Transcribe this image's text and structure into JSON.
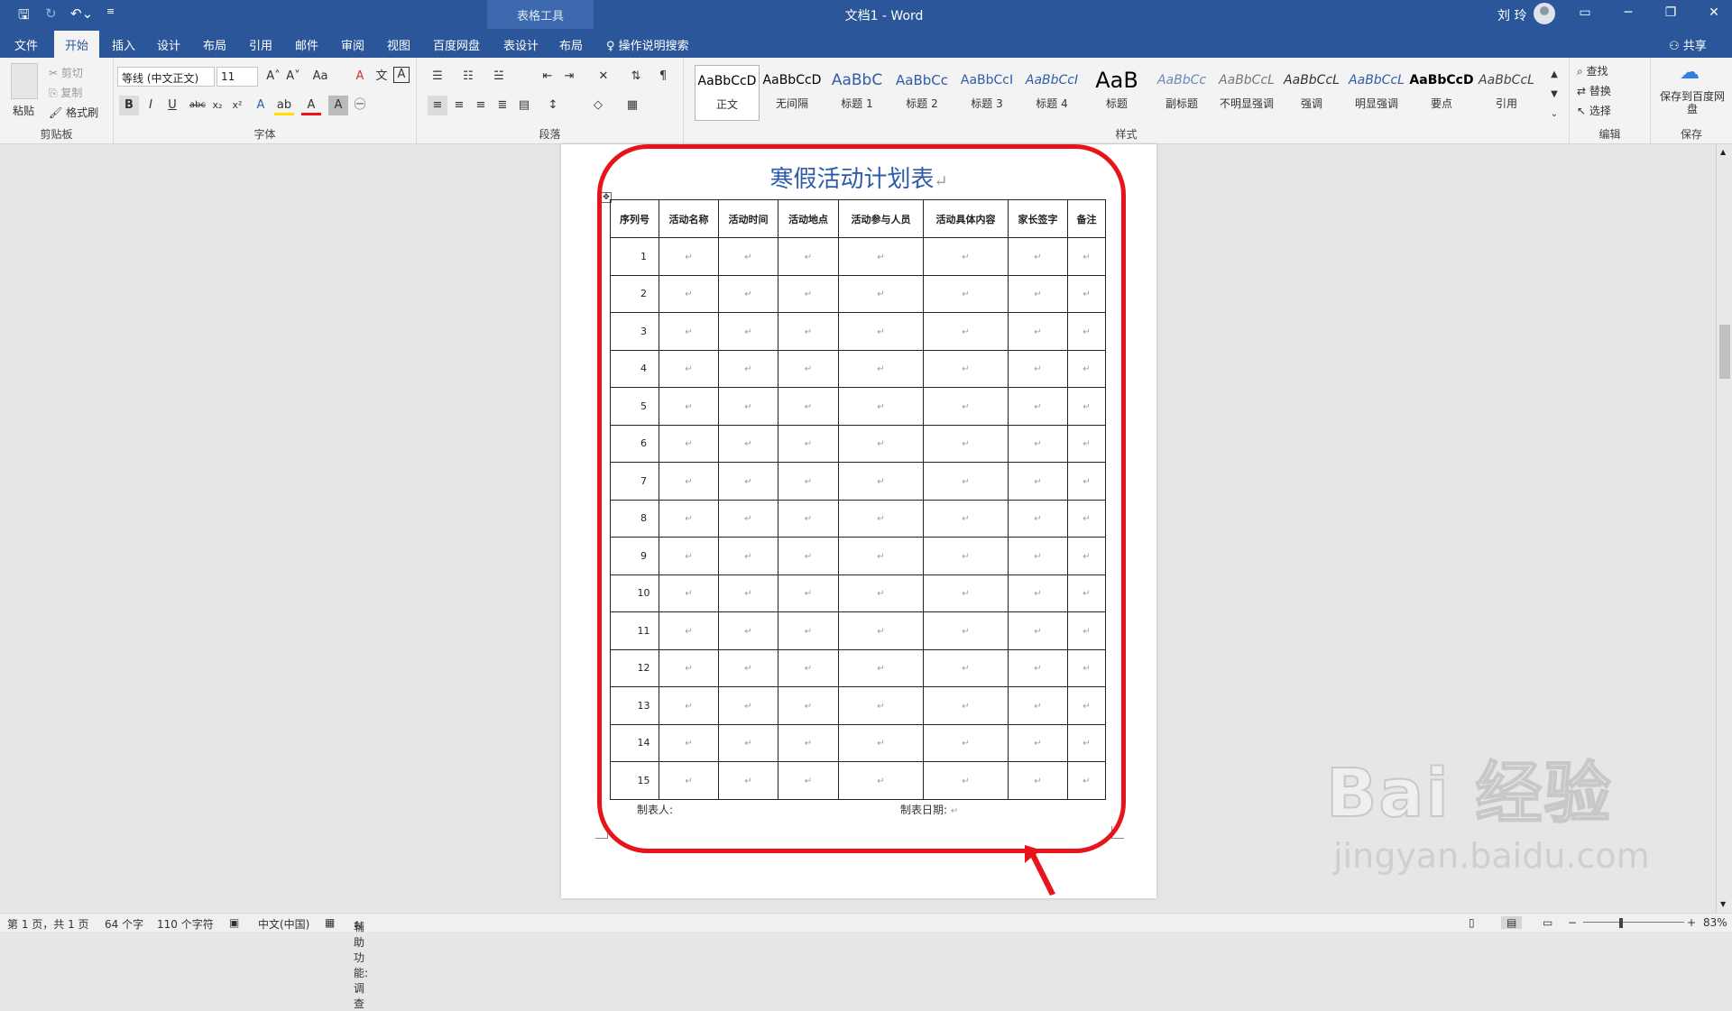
{
  "titlebar": {
    "doc_title": "文档1  -  Word",
    "context_tool": "表格工具",
    "user": "刘 玲",
    "qa_icons": [
      "save-icon",
      "redo-icon",
      "undo-icon",
      "customize-icon"
    ]
  },
  "tabs": [
    "文件",
    "开始",
    "插入",
    "设计",
    "布局",
    "引用",
    "邮件",
    "审阅",
    "视图",
    "百度网盘",
    "表设计",
    "布局"
  ],
  "active_tab": "开始",
  "tell_me": "操作说明搜索",
  "share": "共享",
  "ribbon": {
    "clipboard": {
      "paste": "粘贴",
      "cut": "剪切",
      "copy": "复制",
      "format_painter": "格式刷",
      "label": "剪贴板"
    },
    "font": {
      "name": "等线 (中文正文)",
      "size": "11",
      "label": "字体"
    },
    "paragraph": {
      "label": "段落"
    },
    "styles": {
      "label": "样式",
      "items": [
        {
          "preview": "AaBbCcD",
          "name": "正文",
          "color": "#000000"
        },
        {
          "preview": "AaBbCcD",
          "name": "无间隔",
          "color": "#000000"
        },
        {
          "preview": "AaBbC",
          "name": "标题 1",
          "color": "#2e5da8"
        },
        {
          "preview": "AaBbCc",
          "name": "标题 2",
          "color": "#2e5da8"
        },
        {
          "preview": "AaBbCcI",
          "name": "标题 3",
          "color": "#2e5da8"
        },
        {
          "preview": "AaBbCcI",
          "name": "标题 4",
          "color": "#2e5da8"
        },
        {
          "preview": "AaB",
          "name": "标题",
          "color": "#000000"
        },
        {
          "preview": "AaBbCc",
          "name": "副标题",
          "color": "#6d87b5"
        },
        {
          "preview": "AaBbCcL",
          "name": "不明显强调",
          "color": "#666666"
        },
        {
          "preview": "AaBbCcL",
          "name": "强调",
          "color": "#333333"
        },
        {
          "preview": "AaBbCcL",
          "name": "明显强调",
          "color": "#2e5da8"
        },
        {
          "preview": "AaBbCcD",
          "name": "要点",
          "color": "#000000"
        },
        {
          "preview": "AaBbCcL",
          "name": "引用",
          "color": "#444444"
        }
      ]
    },
    "editing": {
      "find": "查找",
      "replace": "替换",
      "select": "选择",
      "label": "编辑"
    },
    "save": {
      "button": "保存到百度网盘",
      "label": "保存"
    }
  },
  "document": {
    "title": "寒假活动计划表",
    "headers": [
      "序列号",
      "活动名称",
      "活动时间",
      "活动地点",
      "活动参与人员",
      "活动具体内容",
      "家长签字",
      "备注"
    ],
    "rows": [
      "1",
      "2",
      "3",
      "4",
      "5",
      "6",
      "7",
      "8",
      "9",
      "10",
      "11",
      "12",
      "13",
      "14",
      "15"
    ],
    "maker": "制表人:",
    "date": "制表日期:"
  },
  "status": {
    "page": "第 1 页，共 1 页",
    "words": "64 个字",
    "chars": "110 个字符",
    "lang": "中文(中国)",
    "accessibility": "辅助功能: 调查",
    "zoom": "83%"
  },
  "watermark": {
    "brand": "Bai 经验",
    "url": "jingyan.baidu.com"
  },
  "colors": {
    "titlebar": "#2b579a",
    "annotation": "#e8141c",
    "doc_title": "#2e5da8"
  }
}
